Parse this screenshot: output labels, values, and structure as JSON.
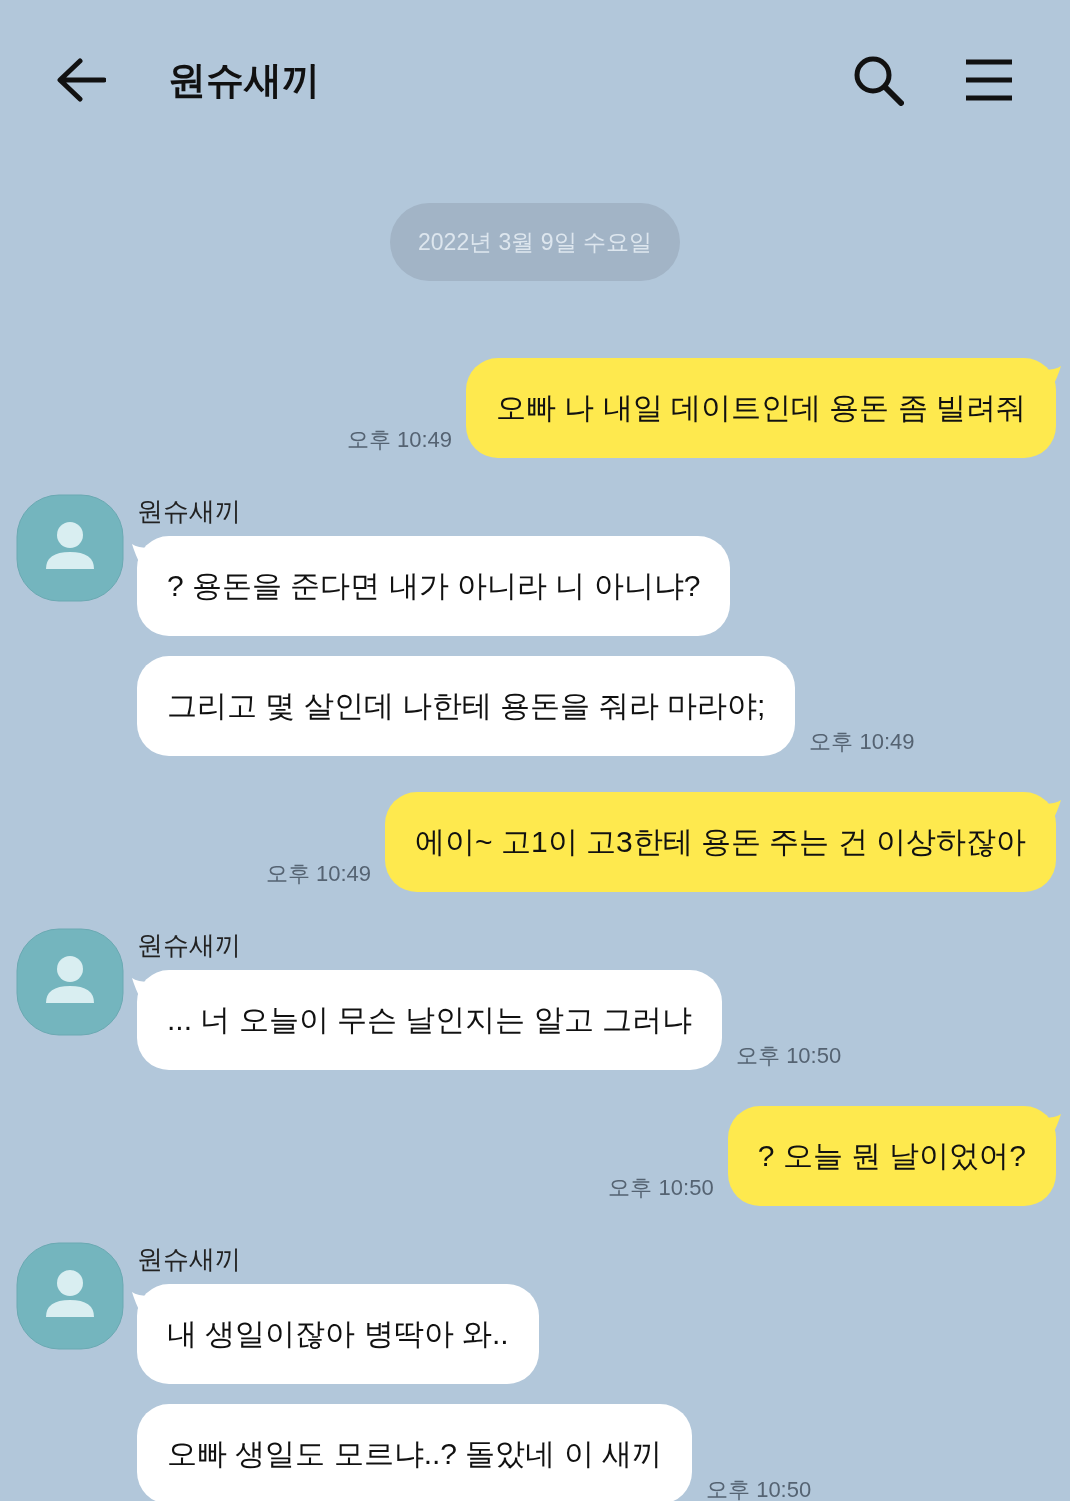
{
  "header": {
    "title": "원슈새끼"
  },
  "date_divider": "2022년 3월 9일 수요일",
  "groups": [
    {
      "kind": "sent",
      "messages": [
        "오빠 나 내일 데이트인데 용돈 좀 빌려줘"
      ],
      "time": "오후 10:49"
    },
    {
      "kind": "received",
      "sender": "원슈새끼",
      "messages": [
        "? 용돈을 준다면 내가 아니라 니 아니냐?",
        "그리고 몇 살인데 나한테 용돈을 줘라 마라야;"
      ],
      "time": "오후 10:49"
    },
    {
      "kind": "sent",
      "messages": [
        "에이~ 고1이 고3한테 용돈 주는 건 이상하잖아"
      ],
      "time": "오후 10:49"
    },
    {
      "kind": "received",
      "sender": "원슈새끼",
      "messages": [
        "... 너 오늘이 무슨 날인지는 알고 그러냐"
      ],
      "time": "오후 10:50"
    },
    {
      "kind": "sent",
      "messages": [
        "? 오늘 뭔 날이었어?"
      ],
      "time": "오후 10:50"
    },
    {
      "kind": "received",
      "sender": "원슈새끼",
      "messages": [
        "내 생일이잖아 병딱아 와..",
        "오빠 생일도 모르냐..? 돌았네 이 새끼"
      ],
      "time": "오후 10:50"
    }
  ]
}
